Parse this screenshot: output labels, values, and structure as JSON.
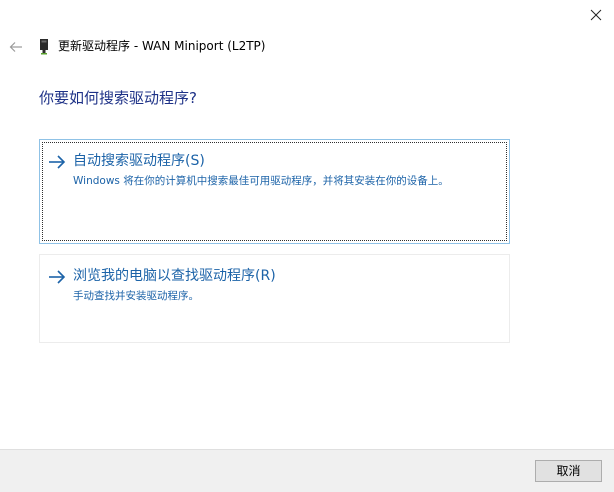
{
  "window": {
    "title": "更新驱动程序 - WAN Miniport (L2TP)",
    "close_icon": "close-icon",
    "back_icon": "back-arrow-icon",
    "device_icon": "network-adapter-icon"
  },
  "main": {
    "heading": "你要如何搜索驱动程序?",
    "options": [
      {
        "title": "自动搜索驱动程序(S)",
        "description": "Windows 将在你的计算机中搜索最佳可用驱动程序，并将其安装在你的设备上。",
        "icon": "arrow-right-icon"
      },
      {
        "title": "浏览我的电脑以查找驱动程序(R)",
        "description": "手动查找并安装驱动程序。",
        "icon": "arrow-right-icon"
      }
    ]
  },
  "footer": {
    "cancel_label": "取消"
  },
  "colors": {
    "heading": "#1e3287",
    "link": "#1c63a8",
    "focus_border": "#8fc2e6",
    "footer_bg": "#f0f0f0"
  }
}
